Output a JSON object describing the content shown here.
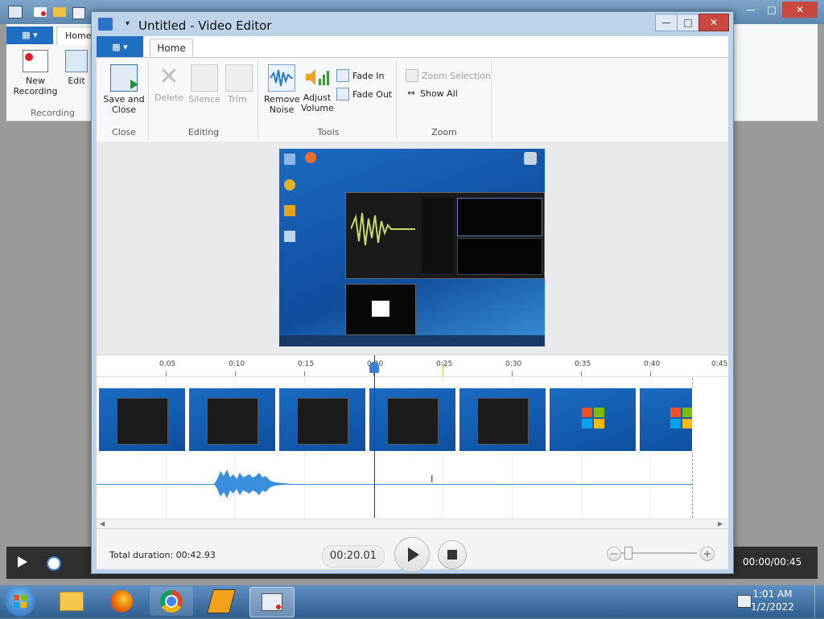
{
  "background_app": {
    "file_tab_label": "",
    "home_tab_label": "Home",
    "new_recording_label_1": "New",
    "new_recording_label_2": "Recording",
    "edit_label": "Edit",
    "group_recording": "Recording",
    "player_time": "00:00/00:45"
  },
  "window": {
    "title": "Untitled - Video Editor",
    "tab_home": "Home"
  },
  "ribbon": {
    "save_close_1": "Save and",
    "save_close_2": "Close",
    "delete": "Delete",
    "silence": "Silence",
    "trim": "Trim",
    "remove_noise_1": "Remove",
    "remove_noise_2": "Noise",
    "adjust_volume_1": "Adjust",
    "adjust_volume_2": "Volume",
    "fade_in": "Fade In",
    "fade_out": "Fade Out",
    "zoom_selection": "Zoom Selection",
    "show_all": "Show All",
    "group_close": "Close",
    "group_editing": "Editing",
    "group_tools": "Tools",
    "group_zoom": "Zoom"
  },
  "timeline": {
    "ticks": [
      "0:05",
      "0:10",
      "0:15",
      "0:20",
      "0:25",
      "0:30",
      "0:35",
      "0:40",
      "0:45"
    ]
  },
  "controls": {
    "total_duration": "Total duration: 00:42.93",
    "current_time": "00:20.01"
  },
  "taskbar": {
    "time": "1:01 AM",
    "date": "1/2/2022"
  }
}
